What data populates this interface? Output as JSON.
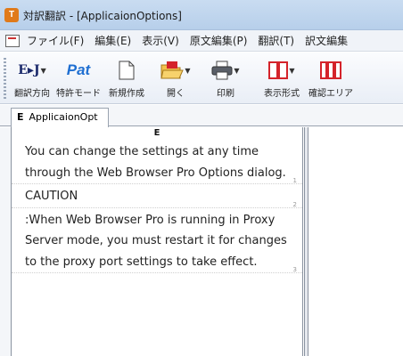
{
  "window": {
    "title": "対訳翻訳 - [ApplicaionOptions]",
    "app_icon_glyph": "T"
  },
  "menu": {
    "items": [
      "ファイル(F)",
      "編集(E)",
      "表示(V)",
      "原文編集(P)",
      "翻訳(T)",
      "訳文編集"
    ]
  },
  "toolbar": {
    "buttons": [
      {
        "label": "翻訳方向",
        "icon": "translation-direction-icon",
        "glyph": "E▸J"
      },
      {
        "label": "特許モード",
        "icon": "patent-mode-icon",
        "glyph": "Pat"
      },
      {
        "label": "新規作成",
        "icon": "new-document-icon"
      },
      {
        "label": "開く",
        "icon": "open-folder-icon"
      },
      {
        "label": "印刷",
        "icon": "printer-icon"
      },
      {
        "label": "表示形式",
        "icon": "display-format-icon"
      },
      {
        "label": "確認エリア",
        "icon": "confirm-area-icon"
      }
    ]
  },
  "tab": {
    "prefix": "E",
    "label": "ApplicaionOpt"
  },
  "pane": {
    "header": "E",
    "segments": [
      {
        "text": "You can change the settings at any time through the Web Browser Pro Options dialog.",
        "number": "1"
      },
      {
        "text": "CAUTION",
        "number": "2"
      },
      {
        "text": ":When Web Browser Pro is running in Proxy Server mode, you must restart it for changes to the proxy port settings to take effect.",
        "number": "3"
      }
    ]
  },
  "colors": {
    "accent_red": "#d4232a",
    "accent_blue": "#1f6fd1",
    "title_bar": "#c9dcf1"
  }
}
